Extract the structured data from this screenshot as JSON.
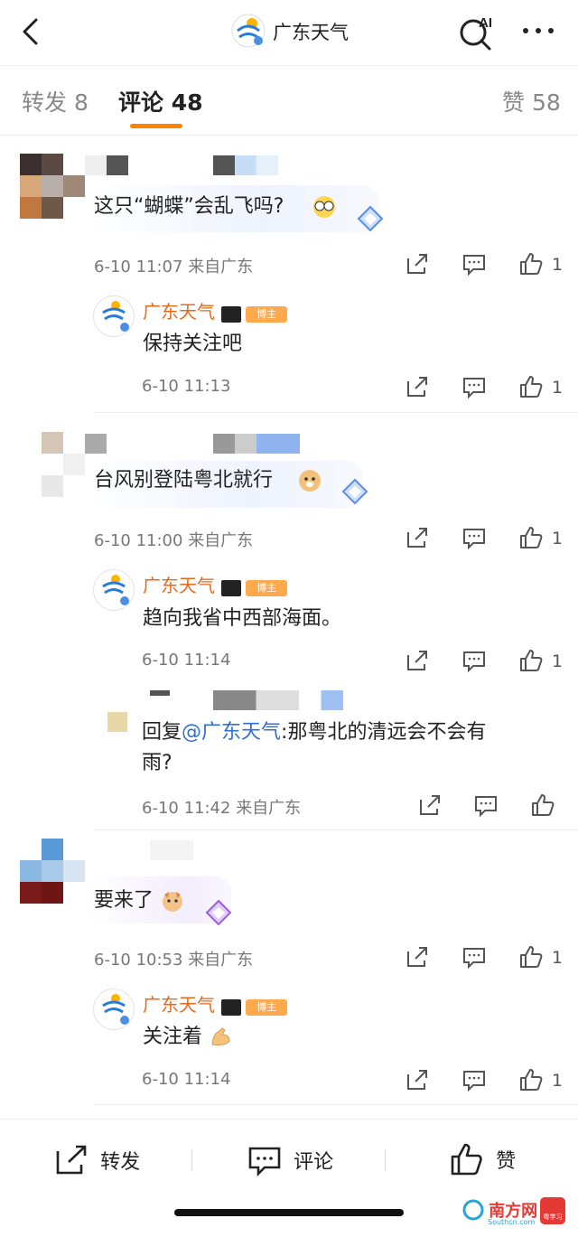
{
  "header": {
    "title": "广东天气",
    "ai_label": "AI"
  },
  "tabs": [
    {
      "label": "转发",
      "count": "8"
    },
    {
      "label": "评论",
      "count": "48"
    },
    {
      "label": "赞",
      "count": "58"
    }
  ],
  "comments": [
    {
      "text": "这只“蝴蝶”会乱飞吗?",
      "time": "6-10 11:07",
      "location": "来自广东",
      "likes": "1",
      "reply": {
        "author": "广东天气",
        "badge": "博主",
        "text": "保持关注吧",
        "time": "6-10 11:13",
        "likes": "1"
      }
    },
    {
      "text": "台风别登陆粤北就行",
      "time": "6-10 11:00",
      "location": "来自广东",
      "likes": "1",
      "reply": {
        "author": "广东天气",
        "badge": "博主",
        "text": "趋向我省中西部海面。",
        "time": "6-10 11:14",
        "likes": "1"
      },
      "subreply": {
        "prefix": "回复",
        "mention": "@广东天气",
        "text_line1": ":那粤北的清远会不会有",
        "text_line2": "雨?",
        "time": "6-10 11:42",
        "location": "来自广东"
      }
    },
    {
      "text": "要来了",
      "time": "6-10 10:53",
      "location": "来自广东",
      "likes": "1",
      "reply": {
        "author": "广东天气",
        "badge": "博主",
        "text": "关注着",
        "time": "6-10 11:14",
        "likes": "1"
      }
    }
  ],
  "bottom": {
    "share": "转发",
    "comment": "评论",
    "like": "赞"
  },
  "watermark": {
    "brand": "南方网",
    "sub": "Southcn.com",
    "app": "粤学习"
  },
  "colors": {
    "accent": "#ff8200",
    "author": "#e46b1a",
    "mention": "#2f6fd6"
  }
}
